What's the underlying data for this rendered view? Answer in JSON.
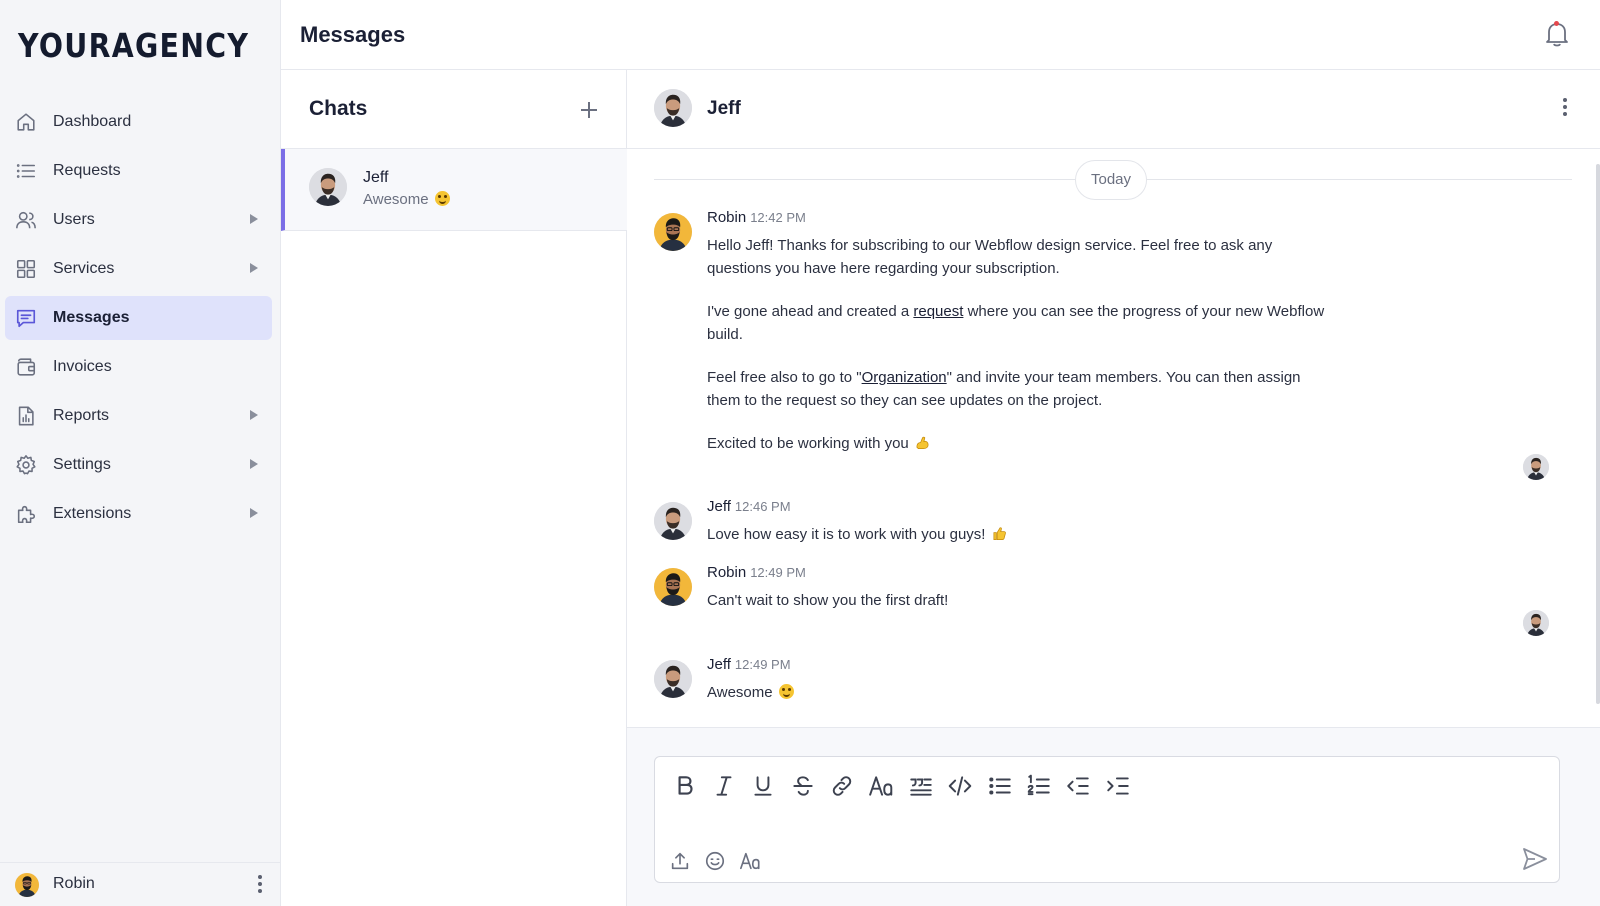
{
  "sidebar": {
    "logo": "YOURAGENCY",
    "items": [
      {
        "label": "Dashboard",
        "icon": "home-icon",
        "active": false,
        "has_submenu": false
      },
      {
        "label": "Requests",
        "icon": "list-icon",
        "active": false,
        "has_submenu": false
      },
      {
        "label": "Users",
        "icon": "users-icon",
        "active": false,
        "has_submenu": true
      },
      {
        "label": "Services",
        "icon": "grid-icon",
        "active": false,
        "has_submenu": true
      },
      {
        "label": "Messages",
        "icon": "message-icon",
        "active": true,
        "has_submenu": false
      },
      {
        "label": "Invoices",
        "icon": "wallet-icon",
        "active": false,
        "has_submenu": false
      },
      {
        "label": "Reports",
        "icon": "report-icon",
        "active": false,
        "has_submenu": true
      },
      {
        "label": "Settings",
        "icon": "gear-icon",
        "active": false,
        "has_submenu": true
      },
      {
        "label": "Extensions",
        "icon": "puzzle-icon",
        "active": false,
        "has_submenu": true
      }
    ],
    "user": {
      "name": "Robin"
    }
  },
  "header": {
    "title": "Messages",
    "notifications_unread": true
  },
  "chats": {
    "title": "Chats",
    "items": [
      {
        "name": "Jeff",
        "preview": "Awesome",
        "preview_emoji": "grinning-face",
        "selected": true
      }
    ]
  },
  "conversation": {
    "contact": "Jeff",
    "date_divider": "Today",
    "messages": [
      {
        "author": "Robin",
        "time": "12:42 PM",
        "p1": "Hello Jeff! Thanks for subscribing to our Webflow design service. Feel free to ask any questions you have here regarding your subscription.",
        "p2_before": "I've gone ahead and created a ",
        "p2_link": "request",
        "p2_after": " where you can see the progress of your new Webflow build.",
        "p3_before": "Feel free also to go to \"",
        "p3_link": "Organization",
        "p3_after": "\" and invite your team members. You can then assign them to the request so they can see updates on the project.",
        "p4": "Excited to be working with you",
        "p4_emoji": "flexed-biceps"
      },
      {
        "author": "Jeff",
        "time": "12:46 PM",
        "text": "Love how easy it is to work with you guys!",
        "emoji": "thumbs-up"
      },
      {
        "author": "Robin",
        "time": "12:49 PM",
        "text": "Can't wait to show you the first draft!"
      },
      {
        "author": "Jeff",
        "time": "12:49 PM",
        "text": "Awesome",
        "emoji": "grinning-face"
      }
    ]
  },
  "composer": {
    "toolbar": [
      "bold-icon",
      "italic-icon",
      "underline-icon",
      "strikethrough-icon",
      "link-icon",
      "font-size-icon",
      "blockquote-icon",
      "code-icon",
      "bullet-list-icon",
      "numbered-list-icon",
      "outdent-icon",
      "indent-icon"
    ],
    "bottom": [
      "upload-icon",
      "emoji-icon",
      "text-format-icon"
    ],
    "send": "send-icon"
  },
  "colors": {
    "accent": "#7b6ee6",
    "active_nav_bg": "#dfe2fb",
    "sidebar_bg": "#f4f5f8",
    "notification_dot": "#e5484d"
  }
}
